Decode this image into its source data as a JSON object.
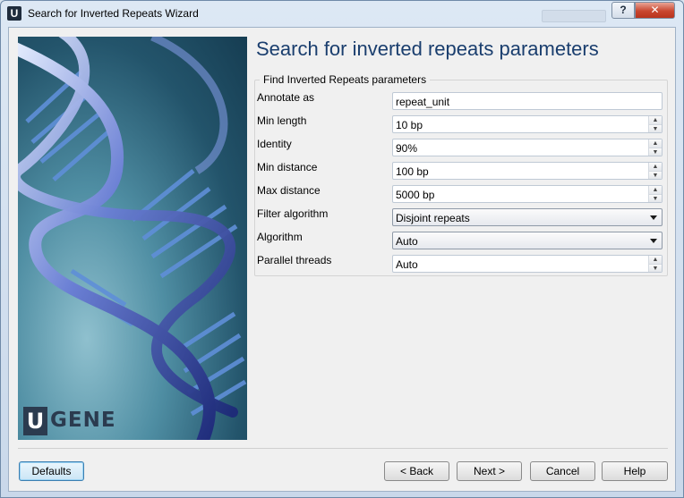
{
  "window": {
    "title": "Search for Inverted Repeats Wizard",
    "app_icon_letter": "U",
    "help_label": "?",
    "close_label": "✕"
  },
  "sidebar": {
    "logo_letter": "U",
    "logo_text": "GENE"
  },
  "page": {
    "title": "Search for inverted repeats parameters",
    "group_title": "Find Inverted Repeats parameters",
    "fields": [
      {
        "label": "Annotate as",
        "value": "repeat_unit",
        "kind": "text"
      },
      {
        "label": "Min length",
        "value": "10 bp",
        "kind": "spinbox"
      },
      {
        "label": "Identity",
        "value": "90%",
        "kind": "spinbox"
      },
      {
        "label": "Min distance",
        "value": "100 bp",
        "kind": "spinbox"
      },
      {
        "label": "Max distance",
        "value": "5000 bp",
        "kind": "spinbox"
      },
      {
        "label": "Filter algorithm",
        "value": "Disjoint repeats",
        "kind": "dropdown"
      },
      {
        "label": "Algorithm",
        "value": "Auto",
        "kind": "dropdown"
      },
      {
        "label": "Parallel threads",
        "value": "Auto",
        "kind": "spinbox"
      }
    ]
  },
  "buttons": {
    "defaults": "Defaults",
    "back": "< Back",
    "next": "Next >",
    "cancel": "Cancel",
    "help": "Help"
  },
  "icons": {
    "spin_up": "▲",
    "spin_down": "▼"
  }
}
